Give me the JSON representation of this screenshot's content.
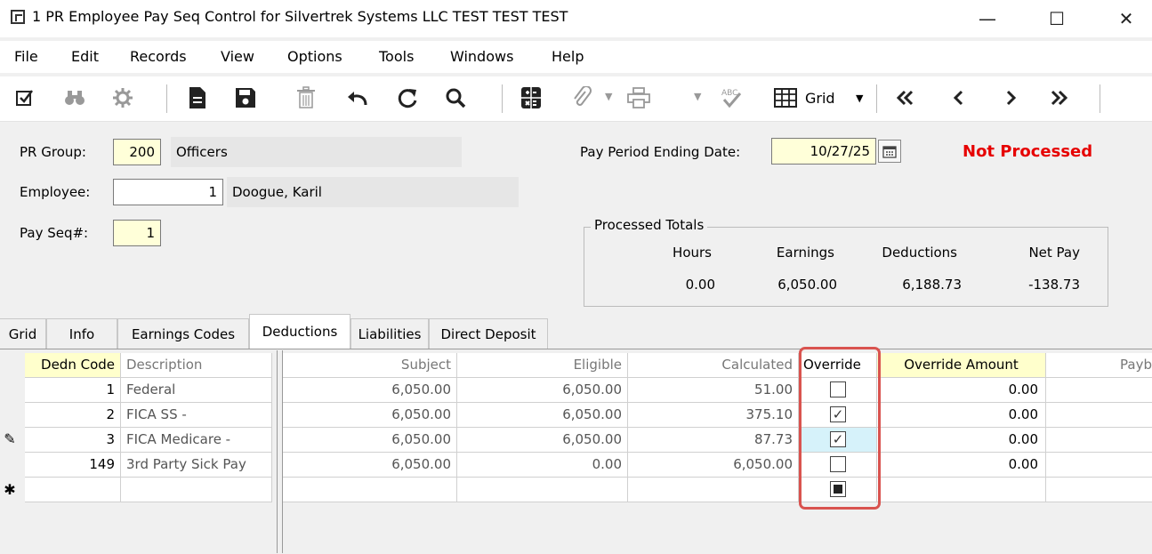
{
  "window": {
    "title": "1 PR Employee Pay Seq Control for Silvertrek Systems LLC TEST TEST TEST",
    "minimize": "—",
    "maximize": "☐",
    "close": "✕"
  },
  "menu": [
    "File",
    "Edit",
    "Records",
    "View",
    "Options",
    "Tools",
    "Windows",
    "Help"
  ],
  "toolbar": {
    "grid_label": "Grid",
    "icons": [
      "edit-check-icon",
      "binoculars-icon",
      "settings-icon",
      "new-document-icon",
      "save-icon",
      "delete-icon",
      "undo-icon",
      "refresh-icon",
      "search-icon",
      "calculator-icon",
      "attachment-icon",
      "print-icon",
      "spellcheck-icon",
      "grid-icon",
      "first-record-icon",
      "previous-record-icon",
      "next-record-icon",
      "last-record-icon"
    ]
  },
  "form": {
    "pr_group_label": "PR Group:",
    "pr_group_value": "200",
    "pr_group_desc": "Officers",
    "employee_label": "Employee:",
    "employee_value": "1",
    "employee_name": "Doogue, Karil",
    "pay_seq_label": "Pay Seq#:",
    "pay_seq_value": "1",
    "pay_period_label": "Pay Period Ending Date:",
    "pay_period_value": "10/27/25",
    "status": "Not Processed"
  },
  "totals": {
    "legend": "Processed Totals",
    "headers": [
      "Hours",
      "Earnings",
      "Deductions",
      "Net Pay"
    ],
    "values": [
      "0.00",
      "6,050.00",
      "6,188.73",
      "-138.73"
    ]
  },
  "tabs": [
    "Grid",
    "Info",
    "Earnings Codes",
    "Deductions",
    "Liabilities",
    "Direct Deposit"
  ],
  "active_tab": "Deductions",
  "grid": {
    "headers": {
      "dedn_code": "Dedn Code",
      "description": "Description",
      "subject": "Subject",
      "eligible": "Eligible",
      "calculated": "Calculated",
      "override": "Override",
      "override_amount": "Override Amount",
      "payback": "Payb"
    },
    "rows": [
      {
        "code": "1",
        "description": "Federal",
        "subject": "6,050.00",
        "eligible": "6,050.00",
        "calculated": "51.00",
        "override": false,
        "override_amount": "0.00"
      },
      {
        "code": "2",
        "description": "FICA SS -",
        "subject": "6,050.00",
        "eligible": "6,050.00",
        "calculated": "375.10",
        "override": true,
        "override_amount": "0.00"
      },
      {
        "code": "3",
        "description": "FICA Medicare -",
        "subject": "6,050.00",
        "eligible": "6,050.00",
        "calculated": "87.73",
        "override": true,
        "override_amount": "0.00"
      },
      {
        "code": "149",
        "description": "3rd Party Sick Pay",
        "subject": "6,050.00",
        "eligible": "0.00",
        "calculated": "6,050.00",
        "override": false,
        "override_amount": "0.00"
      }
    ],
    "edit_row_marker": "✎",
    "new_row_marker": "✱"
  }
}
